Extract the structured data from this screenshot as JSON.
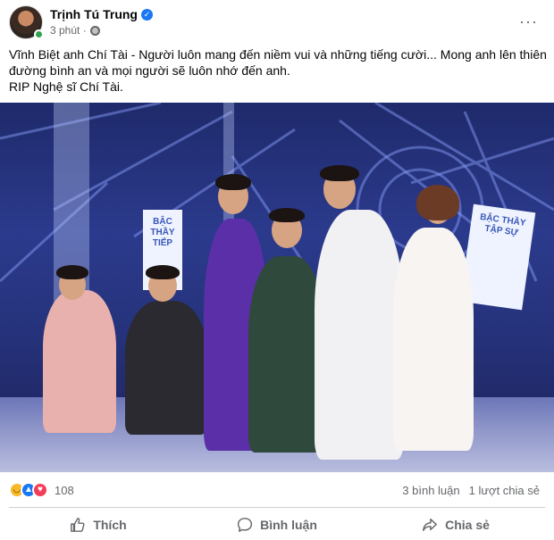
{
  "post": {
    "author": "Trịnh Tú Trung",
    "time": "3 phút ·",
    "text_lines": [
      "Vĩnh Biệt anh Chí Tài - Người luôn mang đến niềm vui và những tiếng cười... Mong anh lên thiên",
      "đường bình an và mọi người sẽ luôn nhớ đến anh.",
      "RIP Nghệ sĩ Chí Tài."
    ],
    "more_label": "···",
    "verified_mark": "✓"
  },
  "photo": {
    "sign_left": "BẬC THẦY TIẾP",
    "sign_right": "BẬC THẦY TẬP SỰ"
  },
  "stats": {
    "reaction_count": "108",
    "comments": "3 bình luận",
    "shares": "1 lượt chia sẻ",
    "reactions": [
      "sad",
      "like",
      "love"
    ]
  },
  "actions": {
    "like": "Thích",
    "comment": "Bình luận",
    "share": "Chia sẻ"
  },
  "colors": {
    "brand": "#1877f2",
    "secondary_text": "#65676b",
    "online": "#31a24c"
  },
  "icons": [
    "globe-icon",
    "verified-badge-icon",
    "more-icon",
    "like-icon",
    "comment-icon",
    "share-icon"
  ]
}
